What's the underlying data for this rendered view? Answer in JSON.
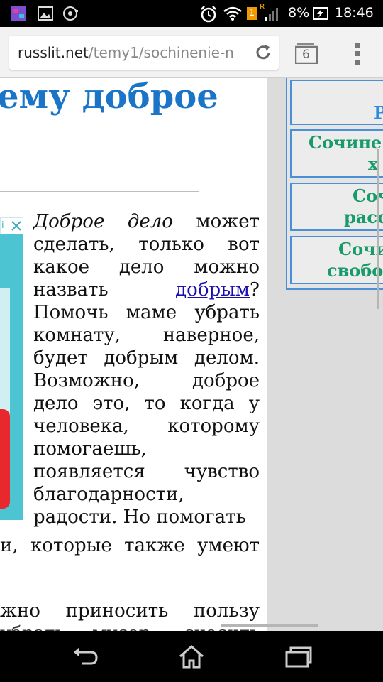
{
  "status_bar": {
    "battery": "8%",
    "time": "18:46",
    "sim_badge": "1",
    "roaming": "R"
  },
  "browser": {
    "url_host": "russlit.net",
    "url_path": "/temy1/sochinenie-n",
    "tab_count": "6"
  },
  "article": {
    "title": "ему доброе",
    "para_lead": "Доброе дело",
    "para_text_1": " может сделать, только вот какое дело можно назвать ",
    "link_text": "добрым",
    "para_text_2": "? Помочь маме убрать комнату, наверное, будет добрым делом. Возможно, доброе дело это, то когда у человека, которому помогаешь, появляется чувство благодарности, радости. Но помогать",
    "line_after_ad": "и, которые также умеют",
    "line_bottom": "жно приносить пользу",
    "line_cut": "убрать мусор, скосить"
  },
  "sidebar_menu": {
    "items": [
      {
        "line1": "Р",
        "line2": ""
      },
      {
        "line1": "Сочине",
        "line2": "х"
      },
      {
        "line1": "Соч",
        "line2": "расс"
      },
      {
        "line1": "Сочи",
        "line2": "свобо"
      }
    ]
  },
  "ad": {
    "info": "i"
  }
}
